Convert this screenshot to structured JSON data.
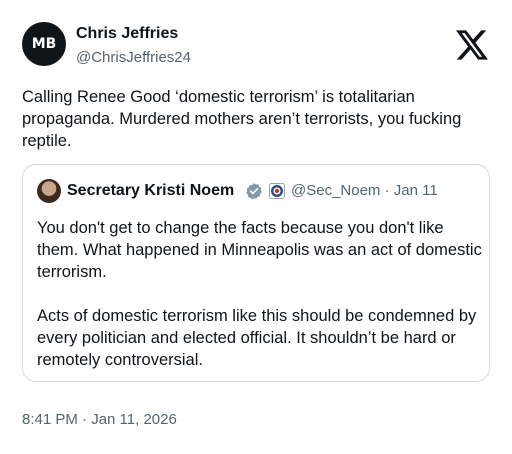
{
  "author": {
    "display_name": "Chris Jeffries",
    "handle": "@ChrisJeffries24",
    "avatar_icon": "mb-logo-avatar",
    "avatar_text": "MB"
  },
  "tweet": {
    "text": "Calling Renee Good ‘domestic terrorism’ is totalitarian propaganda. Murdered mothers aren’t terrorists, you fucking reptile.",
    "timestamp": "8:41 PM · Jan 11, 2026"
  },
  "quoted": {
    "display_name": "Secretary Kristi Noem",
    "handle": "@Sec_Noem",
    "separator": "·",
    "date": "Jan 11",
    "verified_icon": "verified-badge-icon",
    "gov_icon": "government-seal-icon",
    "paragraphs": [
      "You don't get to change the facts because you don't like them. What happened in Minneapolis was an act of domestic terrorism.",
      "Acts of domestic terrorism like this should be condemned by every politician and elected official. It shouldn’t be hard or remotely controversial."
    ]
  },
  "brand": {
    "logo_icon": "x-logo-icon"
  },
  "colors": {
    "text": "#0f1419",
    "secondary": "#536471",
    "border": "#cfd9de",
    "verified_gray": "#829aab"
  }
}
